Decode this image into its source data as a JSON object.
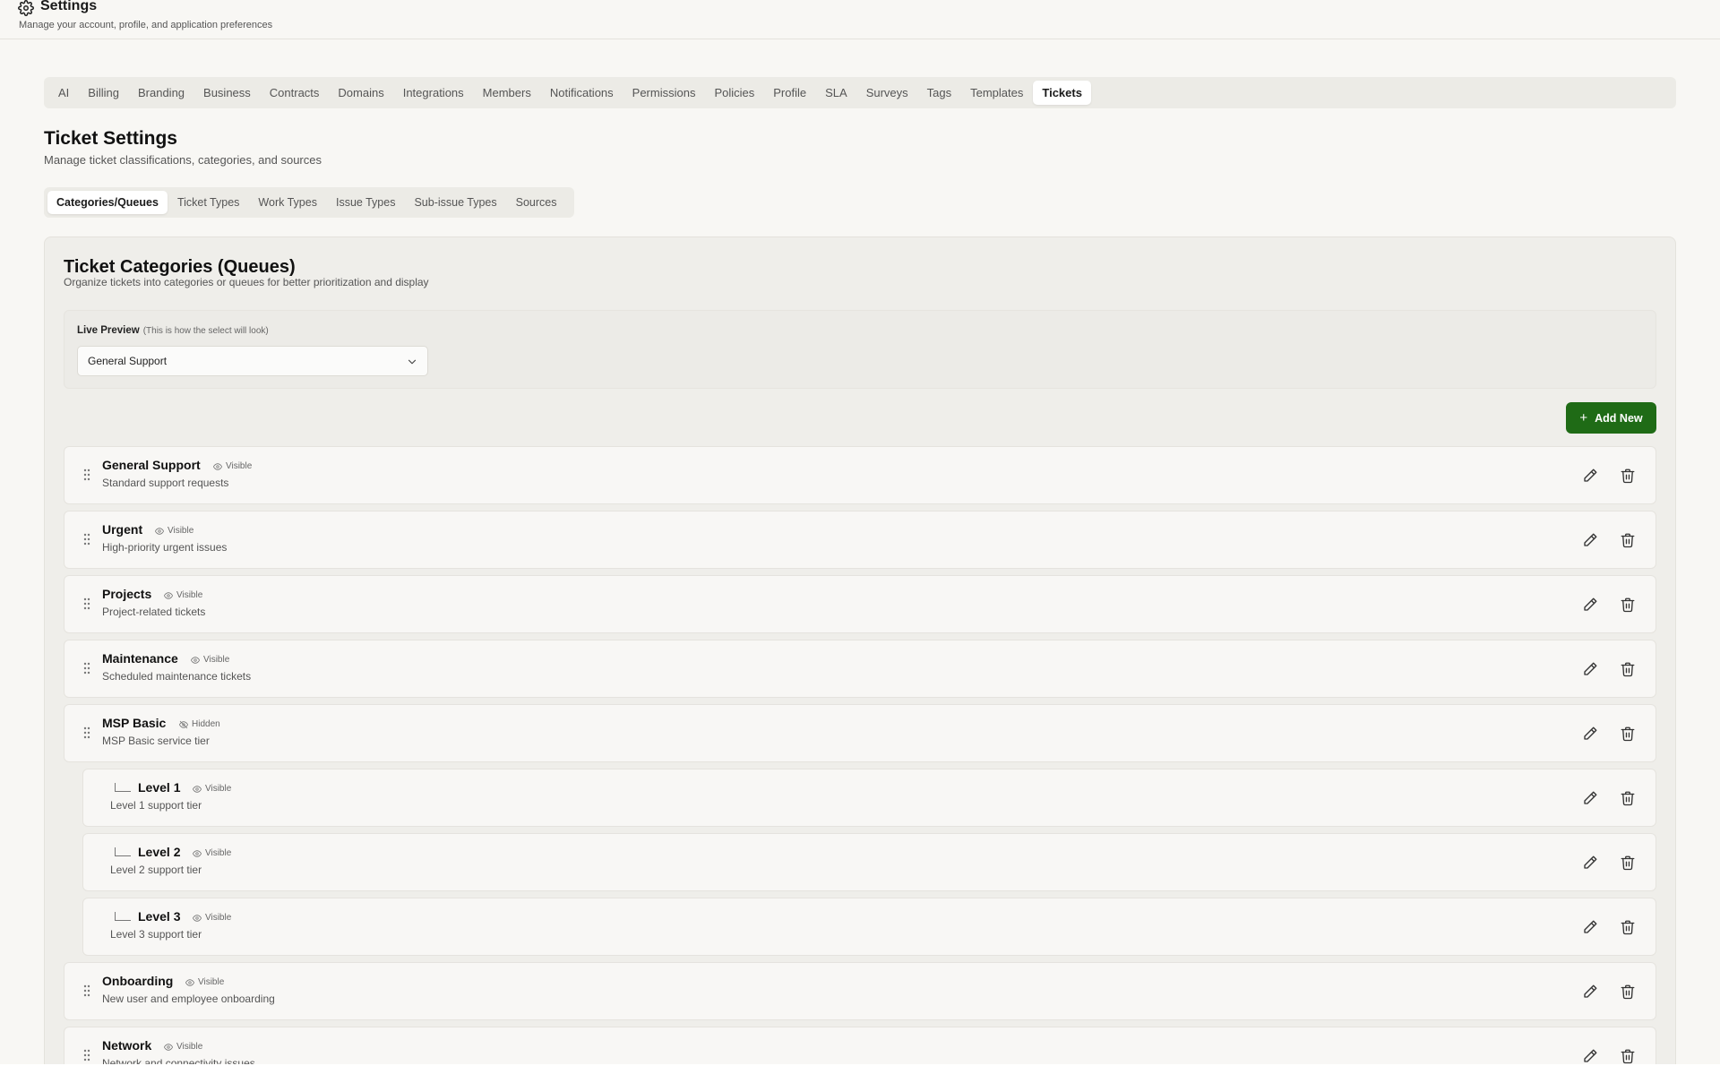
{
  "header": {
    "title": "Settings",
    "subtitle": "Manage your account, profile, and application preferences"
  },
  "top_tabs": [
    "AI",
    "Billing",
    "Branding",
    "Business",
    "Contracts",
    "Domains",
    "Integrations",
    "Members",
    "Notifications",
    "Permissions",
    "Policies",
    "Profile",
    "SLA",
    "Surveys",
    "Tags",
    "Templates",
    "Tickets"
  ],
  "active_top_tab": "Tickets",
  "page": {
    "title": "Ticket Settings",
    "subtitle": "Manage ticket classifications, categories, and sources"
  },
  "sub_tabs": [
    "Categories/Queues",
    "Ticket Types",
    "Work Types",
    "Issue Types",
    "Sub-issue Types",
    "Sources"
  ],
  "active_sub_tab": "Categories/Queues",
  "card": {
    "title": "Ticket Categories (Queues)",
    "subtitle": "Organize tickets into categories or queues for better prioritization and display"
  },
  "preview": {
    "label": "Live Preview",
    "hint": "(This is how the select will look)",
    "selected": "General Support"
  },
  "add_button": "Add New",
  "categories": [
    {
      "name": "General Support",
      "desc": "Standard support requests",
      "status": "Visible",
      "child": false
    },
    {
      "name": "Urgent",
      "desc": "High-priority urgent issues",
      "status": "Visible",
      "child": false
    },
    {
      "name": "Projects",
      "desc": "Project-related tickets",
      "status": "Visible",
      "child": false
    },
    {
      "name": "Maintenance",
      "desc": "Scheduled maintenance tickets",
      "status": "Visible",
      "child": false
    },
    {
      "name": "MSP Basic",
      "desc": "MSP Basic service tier",
      "status": "Hidden",
      "child": false
    },
    {
      "name": "Level 1",
      "desc": "Level 1 support tier",
      "status": "Visible",
      "child": true
    },
    {
      "name": "Level 2",
      "desc": "Level 2 support tier",
      "status": "Visible",
      "child": true
    },
    {
      "name": "Level 3",
      "desc": "Level 3 support tier",
      "status": "Visible",
      "child": true
    },
    {
      "name": "Onboarding",
      "desc": "New user and employee onboarding",
      "status": "Visible",
      "child": false
    },
    {
      "name": "Network",
      "desc": "Network and connectivity issues",
      "status": "Visible",
      "child": false
    }
  ],
  "colors": {
    "accent": "#1f6b16",
    "background": "#f8f7f4",
    "card": "#efeeea"
  }
}
